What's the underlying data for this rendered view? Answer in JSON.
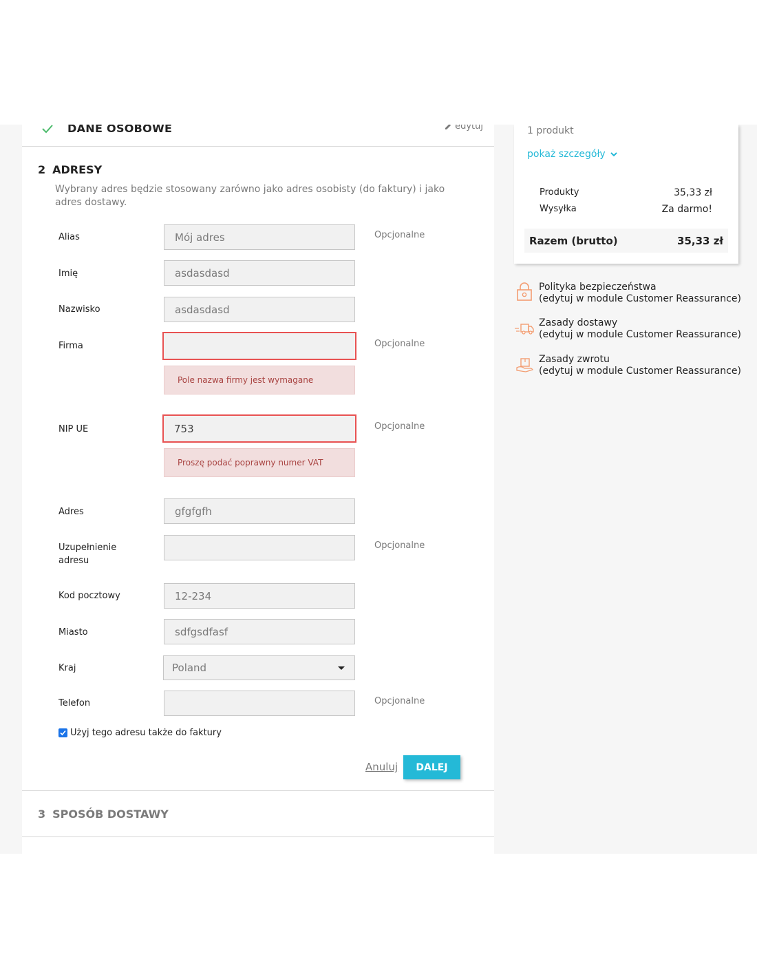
{
  "step1": {
    "title": "Dane osobowe",
    "edit_label": "edytuj"
  },
  "step2": {
    "number": "2",
    "title": "ADRESY",
    "description": "Wybrany adres będzie stosowany zarówno jako adres osobisty (do faktury) i jako adres dostawy.",
    "optional_label": "Opcjonalne",
    "fields": {
      "alias": {
        "label": "Alias",
        "value": "",
        "placeholder": "Mój adres"
      },
      "firstname": {
        "label": "Imię",
        "value": "asdasdasd"
      },
      "lastname": {
        "label": "Nazwisko",
        "value": "asdasdasd"
      },
      "company": {
        "label": "Firma",
        "value": "",
        "error": "Pole nazwa firmy jest wymagane"
      },
      "vat": {
        "label": "NIP UE",
        "value": "753",
        "error": "Proszę podać poprawny numer VAT"
      },
      "address1": {
        "label": "Adres",
        "value": "gfgfgfh"
      },
      "address2": {
        "label": "Uzupełnienie adresu",
        "value": ""
      },
      "postcode": {
        "label": "Kod pocztowy",
        "value": "12-234"
      },
      "city": {
        "label": "Miasto",
        "value": "sdfgsdfasf"
      },
      "country": {
        "label": "Kraj",
        "selected": "Poland"
      },
      "phone": {
        "label": "Telefon",
        "value": ""
      }
    },
    "invoice_checkbox": {
      "label": "Użyj tego adresu także do faktury",
      "checked": true
    },
    "cancel_label": "Anuluj",
    "next_label": "Dalej"
  },
  "step3": {
    "number": "3",
    "title": "SPOSÓB DOSTAWY"
  },
  "cart": {
    "product_count": "1 produkt",
    "show_details": "pokaż szczegóły",
    "subtotals": [
      {
        "label": "Produkty",
        "value": "35,33 zł"
      },
      {
        "label": "Wysyłka",
        "value": "Za darmo!"
      }
    ],
    "total_label": "Razem (brutto)",
    "total_value": "35,33 zł"
  },
  "reassurance": [
    {
      "title": "Polityka bezpieczeństwa",
      "subtitle": "(edytuj w module Customer Reassurance)",
      "icon": "lock-icon"
    },
    {
      "title": "Zasady dostawy",
      "subtitle": "(edytuj w module Customer Reassurance)",
      "icon": "delivery-truck-icon"
    },
    {
      "title": "Zasady zwrotu",
      "subtitle": "(edytuj w module Customer Reassurance)",
      "icon": "return-package-icon"
    }
  ],
  "colors": {
    "accent": "#24b9d7",
    "error_border": "#e85252",
    "error_bg": "#f2dede",
    "error_text": "#a94442",
    "check_green": "#4cbb6c",
    "reassurance_orange": "#f39d72"
  }
}
